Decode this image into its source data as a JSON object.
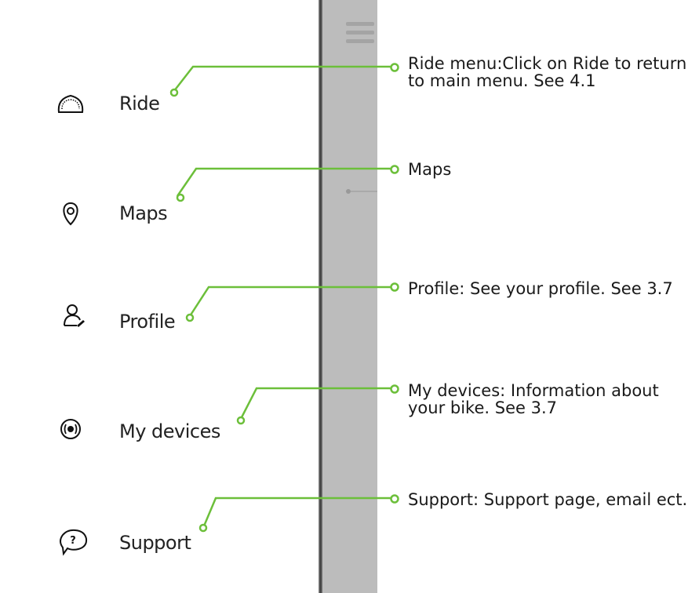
{
  "menu": [
    {
      "label": "Ride",
      "icon": "speedometer-icon"
    },
    {
      "label": "Maps",
      "icon": "map-pin-icon"
    },
    {
      "label": "Profile",
      "icon": "user-icon"
    },
    {
      "label": "My devices",
      "icon": "device-icon"
    },
    {
      "label": "Support",
      "icon": "help-bubble-icon"
    }
  ],
  "annotations": [
    {
      "text": "Ride menu:Click on Ride to return to main menu. See 4.1"
    },
    {
      "text": "Maps"
    },
    {
      "text": "Profile: See your profile. See 3.7"
    },
    {
      "text": "My devices: Information about your bike. See 3.7"
    },
    {
      "text": "Support: Support page, email ect."
    }
  ],
  "colors": {
    "callout": "#6cbf3a",
    "overlay": "#bcbcbc",
    "text": "#222222"
  }
}
